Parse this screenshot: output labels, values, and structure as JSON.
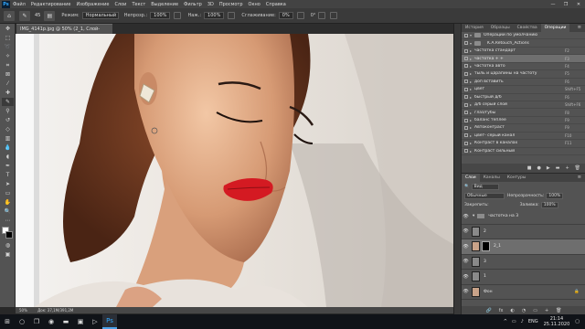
{
  "app": {
    "logo": "Ps"
  },
  "menu": [
    "Файл",
    "Редактирование",
    "Изображение",
    "Слои",
    "Текст",
    "Выделение",
    "Фильтр",
    "3D",
    "Просмотр",
    "Окно",
    "Справка"
  ],
  "window_controls": [
    "—",
    "❐",
    "✕"
  ],
  "options": {
    "mode_label": "Режим:",
    "mode_value": "Нормальный",
    "opacity_label": "Непрозр.:",
    "opacity_value": "100%",
    "flow_label": "Наж.:",
    "flow_value": "100%",
    "smoothing_label": "Сглаживание:",
    "smoothing_value": "0%",
    "angle_value": "0°",
    "brush_size": "45"
  },
  "document": {
    "tab_title": "IMG_4141p.jpg @ 50% (2_1, Слой-маска/8) *"
  },
  "status": {
    "zoom": "50%",
    "doc_size": "Док: 37,1М/391,2М"
  },
  "actions_panel": {
    "tabs": [
      "История",
      "Образцы",
      "Свойства",
      "Операции"
    ],
    "active_tab": "Операции",
    "items": [
      {
        "name": "Операции по умолчанию",
        "key": ""
      },
      {
        "name": "K.A.Retouch_Actions",
        "key": ""
      },
      {
        "name": "частотка стандарт",
        "key": "F2"
      },
      {
        "name": "частотка + +",
        "key": "F3"
      },
      {
        "name": "частотка авто",
        "key": "F4"
      },
      {
        "name": "тыль и царапины на частоту",
        "key": "F5"
      },
      {
        "name": "доп вставить",
        "key": "F6"
      },
      {
        "name": "цвет",
        "key": "Shift+F5"
      },
      {
        "name": "быстрый д/б",
        "key": "F6"
      },
      {
        "name": "д/б серый слой",
        "key": "Shift+F6"
      },
      {
        "name": "глаз/губы",
        "key": "F8"
      },
      {
        "name": "баланс теплее",
        "key": "F9"
      },
      {
        "name": "Автоконтраст",
        "key": "F9"
      },
      {
        "name": "цвет- серый канал",
        "key": "F10"
      },
      {
        "name": "Контраст в каналах",
        "key": "F11"
      },
      {
        "name": "Контраст сильный",
        "key": ""
      }
    ],
    "footer_icons": [
      "■",
      "●",
      "▶",
      "▬",
      "+",
      "🗑"
    ]
  },
  "layers_panel": {
    "tabs": [
      "Слои",
      "Каналы",
      "Контуры"
    ],
    "active_tab": "Слои",
    "filter_label": "Вид",
    "blend_mode": "Обычные",
    "opacity_label": "Непрозрачность:",
    "opacity_value": "100%",
    "lock_label": "Закрепить:",
    "fill_label": "Заливка:",
    "fill_value": "100%",
    "layers": [
      {
        "name": "частотка на 3",
        "type": "group"
      },
      {
        "name": "2",
        "type": "layer"
      },
      {
        "name": "2_1",
        "type": "masked"
      },
      {
        "name": "3",
        "type": "layer"
      },
      {
        "name": "1",
        "type": "layer"
      },
      {
        "name": "Фон",
        "type": "bg"
      }
    ],
    "footer_icons": [
      "🔗",
      "fx",
      "◐",
      "◔",
      "▭",
      "+",
      "🗑"
    ]
  },
  "taskbar": {
    "lang": "ENG",
    "time": "21:14",
    "date": "25.11.2020"
  },
  "colors": {
    "accent": "#31a8ff",
    "panel_bg": "#535353",
    "app_bg": "#282828",
    "lips": "#d41a22"
  }
}
